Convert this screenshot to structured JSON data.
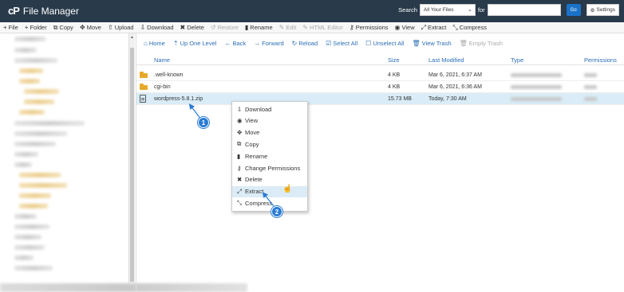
{
  "app": {
    "logo": "cP",
    "title": "File Manager"
  },
  "search": {
    "label": "Search",
    "scope": "All Your Files",
    "for_label": "for",
    "query": "",
    "go_label": "Go",
    "settings_label": "Settings"
  },
  "toolbar": [
    {
      "icon": "plus-icon",
      "glyph": "+",
      "label": "File",
      "enabled": true
    },
    {
      "icon": "plus-icon",
      "glyph": "+",
      "label": "Folder",
      "enabled": true
    },
    {
      "icon": "copy-icon",
      "glyph": "⧉",
      "label": "Copy",
      "enabled": true
    },
    {
      "icon": "move-icon",
      "glyph": "✥",
      "label": "Move",
      "enabled": true
    },
    {
      "icon": "upload-icon",
      "glyph": "⇧",
      "label": "Upload",
      "enabled": true
    },
    {
      "icon": "download-icon",
      "glyph": "⇩",
      "label": "Download",
      "enabled": true
    },
    {
      "icon": "delete-icon",
      "glyph": "✖",
      "label": "Delete",
      "enabled": true
    },
    {
      "icon": "restore-icon",
      "glyph": "↺",
      "label": "Restore",
      "enabled": false
    },
    {
      "icon": "rename-icon",
      "glyph": "▮",
      "label": "Rename",
      "enabled": true
    },
    {
      "icon": "edit-icon",
      "glyph": "✎",
      "label": "Edit",
      "enabled": false
    },
    {
      "icon": "html-editor-icon",
      "glyph": "✎",
      "label": "HTML Editor",
      "enabled": false
    },
    {
      "icon": "key-icon",
      "glyph": "⚷",
      "label": "Permissions",
      "enabled": true
    },
    {
      "icon": "eye-icon",
      "glyph": "◉",
      "label": "View",
      "enabled": true
    },
    {
      "icon": "extract-icon",
      "glyph": "⤢",
      "label": "Extract",
      "enabled": true
    },
    {
      "icon": "compress-icon",
      "glyph": "⤡",
      "label": "Compress",
      "enabled": true
    }
  ],
  "nav": [
    {
      "icon": "home-icon",
      "glyph": "⌂",
      "label": "Home",
      "enabled": true
    },
    {
      "icon": "up-level-icon",
      "glyph": "⇡",
      "label": "Up One Level",
      "enabled": true
    },
    {
      "icon": "back-icon",
      "glyph": "←",
      "label": "Back",
      "enabled": true
    },
    {
      "icon": "forward-icon",
      "glyph": "→",
      "label": "Forward",
      "enabled": true
    },
    {
      "icon": "reload-icon",
      "glyph": "↻",
      "label": "Reload",
      "enabled": true
    },
    {
      "icon": "select-all-icon",
      "glyph": "☑",
      "label": "Select All",
      "enabled": true
    },
    {
      "icon": "unselect-all-icon",
      "glyph": "☐",
      "label": "Unselect All",
      "enabled": true
    },
    {
      "icon": "view-trash-icon",
      "glyph": "🗑",
      "label": "View Trash",
      "enabled": true
    },
    {
      "icon": "empty-trash-icon",
      "glyph": "🗑",
      "label": "Empty Trash",
      "enabled": false
    }
  ],
  "table": {
    "headers": {
      "name": "Name",
      "size": "Size",
      "modified": "Last Modified",
      "type": "Type",
      "permissions": "Permissions"
    },
    "rows": [
      {
        "kind": "folder",
        "name": ".well-known",
        "size": "4 KB",
        "modified": "Mar 6, 2021, 6:37 AM",
        "selected": false
      },
      {
        "kind": "folder",
        "name": "cgi-bin",
        "size": "4 KB",
        "modified": "Mar 6, 2021, 6:36 AM",
        "selected": false
      },
      {
        "kind": "file",
        "name": "wordpress-5.8.1.zip",
        "size": "15.73 MB",
        "modified": "Today, 7:30 AM",
        "selected": true
      }
    ]
  },
  "context_menu": [
    {
      "icon": "download-icon",
      "glyph": "⇩",
      "label": "Download"
    },
    {
      "icon": "eye-icon",
      "glyph": "◉",
      "label": "View"
    },
    {
      "icon": "move-icon",
      "glyph": "✥",
      "label": "Move"
    },
    {
      "icon": "copy-icon",
      "glyph": "⧉",
      "label": "Copy"
    },
    {
      "icon": "rename-icon",
      "glyph": "▮",
      "label": "Rename"
    },
    {
      "icon": "key-icon",
      "glyph": "⚷",
      "label": "Change Permissions"
    },
    {
      "icon": "delete-icon",
      "glyph": "✖",
      "label": "Delete"
    },
    {
      "icon": "extract-icon",
      "glyph": "⤢",
      "label": "Extract",
      "hover": true
    },
    {
      "icon": "compress-icon",
      "glyph": "⤡",
      "label": "Compress"
    }
  ],
  "annotations": [
    {
      "label": "1"
    },
    {
      "label": "2"
    }
  ],
  "colors": {
    "header_bg": "#293a4a",
    "link": "#2a6db5",
    "selected_row": "#d9ecf7",
    "folder": "#e8a92a",
    "badge": "#2a7bd4"
  }
}
